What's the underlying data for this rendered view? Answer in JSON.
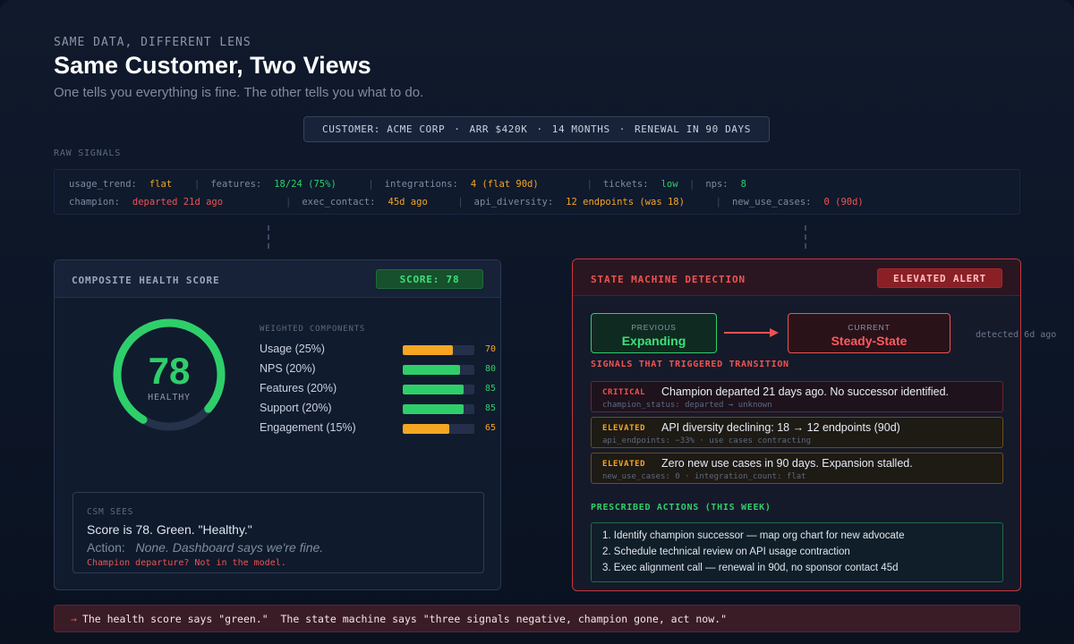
{
  "header": {
    "eyebrow": "SAME DATA, DIFFERENT LENS",
    "title": "Same Customer, Two Views",
    "subtitle": "One tells you everything is fine. The other tells you what to do."
  },
  "customer_bar": {
    "items": [
      "CUSTOMER: ACME CORP",
      "ARR $420K",
      "14 MONTHS",
      "RENEWAL IN 90 DAYS"
    ],
    "separator": "·"
  },
  "raw_signals": {
    "label": "RAW SIGNALS",
    "row1": [
      {
        "key": "usage_trend:",
        "value": "flat",
        "color": "#f5a623"
      },
      {
        "key": "features:",
        "value": "18/24 (75%)",
        "color": "#2ecf6a"
      },
      {
        "key": "integrations:",
        "value": "4 (flat 90d)",
        "color": "#f5a623"
      },
      {
        "key": "tickets:",
        "value": "low",
        "color": "#2ecf6a"
      },
      {
        "key": "nps:",
        "value": "8",
        "color": "#2ecf6a"
      }
    ],
    "row2": [
      {
        "key": "champion:",
        "value": "departed 21d ago",
        "color": "#f05252"
      },
      {
        "key": "exec_contact:",
        "value": "45d ago",
        "color": "#f5a623"
      },
      {
        "key": "api_diversity:",
        "value": "12 endpoints (was 18)",
        "color": "#f5a623"
      },
      {
        "key": "new_use_cases:",
        "value": "0 (90d)",
        "color": "#f05252"
      }
    ],
    "separator": "|"
  },
  "health_panel": {
    "title": "COMPOSITE HEALTH SCORE",
    "badge": "SCORE: 78",
    "score": "78",
    "score_value": 78,
    "score_label": "HEALTHY",
    "components_label": "WEIGHTED COMPONENTS",
    "components": [
      {
        "name": "Usage (25%)",
        "value": 70,
        "display": "70",
        "color": "#f5a623"
      },
      {
        "name": "NPS (20%)",
        "value": 80,
        "display": "80",
        "color": "#2ecf6a"
      },
      {
        "name": "Features (20%)",
        "value": 85,
        "display": "85",
        "color": "#2ecf6a"
      },
      {
        "name": "Support (20%)",
        "value": 85,
        "display": "85",
        "color": "#2ecf6a"
      },
      {
        "name": "Engagement (15%)",
        "value": 65,
        "display": "65",
        "color": "#f5a623"
      }
    ],
    "csm": {
      "label": "CSM SEES",
      "line1": "Score is 78. Green. \"Healthy.\"",
      "action_label": "Action:",
      "action_text": "None. Dashboard says we're fine.",
      "warning": "Champion departure? Not in the model."
    }
  },
  "state_panel": {
    "title": "STATE MACHINE DETECTION",
    "badge": "ELEVATED ALERT",
    "previous_label": "PREVIOUS",
    "previous_state": "Expanding",
    "current_label": "CURRENT",
    "current_state": "Steady-State",
    "detected": "detected 6d ago",
    "signals_title": "SIGNALS THAT TRIGGERED TRANSITION",
    "signals": [
      {
        "level": "CRITICAL",
        "text": "Champion departed 21 days ago. No successor identified.",
        "meta": "champion_status: departed → unknown"
      },
      {
        "level": "ELEVATED",
        "text": "API diversity declining: 18 → 12 endpoints (90d)",
        "meta": "api_endpoints: −33% · use cases contracting"
      },
      {
        "level": "ELEVATED",
        "text": "Zero new use cases in 90 days. Expansion stalled.",
        "meta": "new_use_cases: 0 · integration_count: flat"
      }
    ],
    "actions_title": "PRESCRIBED ACTIONS (THIS WEEK)",
    "actions": [
      "1. Identify champion successor — map org chart for new advocate",
      "2. Schedule technical review on API usage contraction",
      "3. Exec alignment call — renewal in 90d, no sponsor contact 45d"
    ]
  },
  "footer": {
    "arrow": "→",
    "text": "The health score says \"green.\"  The state machine says \"three signals negative, champion gone, act now.\""
  },
  "colors": {
    "green": "#2ecf6a",
    "amber": "#f5a623",
    "red": "#f05252"
  },
  "icons": [
    "arrow-right-icon",
    "health-gauge-icon"
  ]
}
